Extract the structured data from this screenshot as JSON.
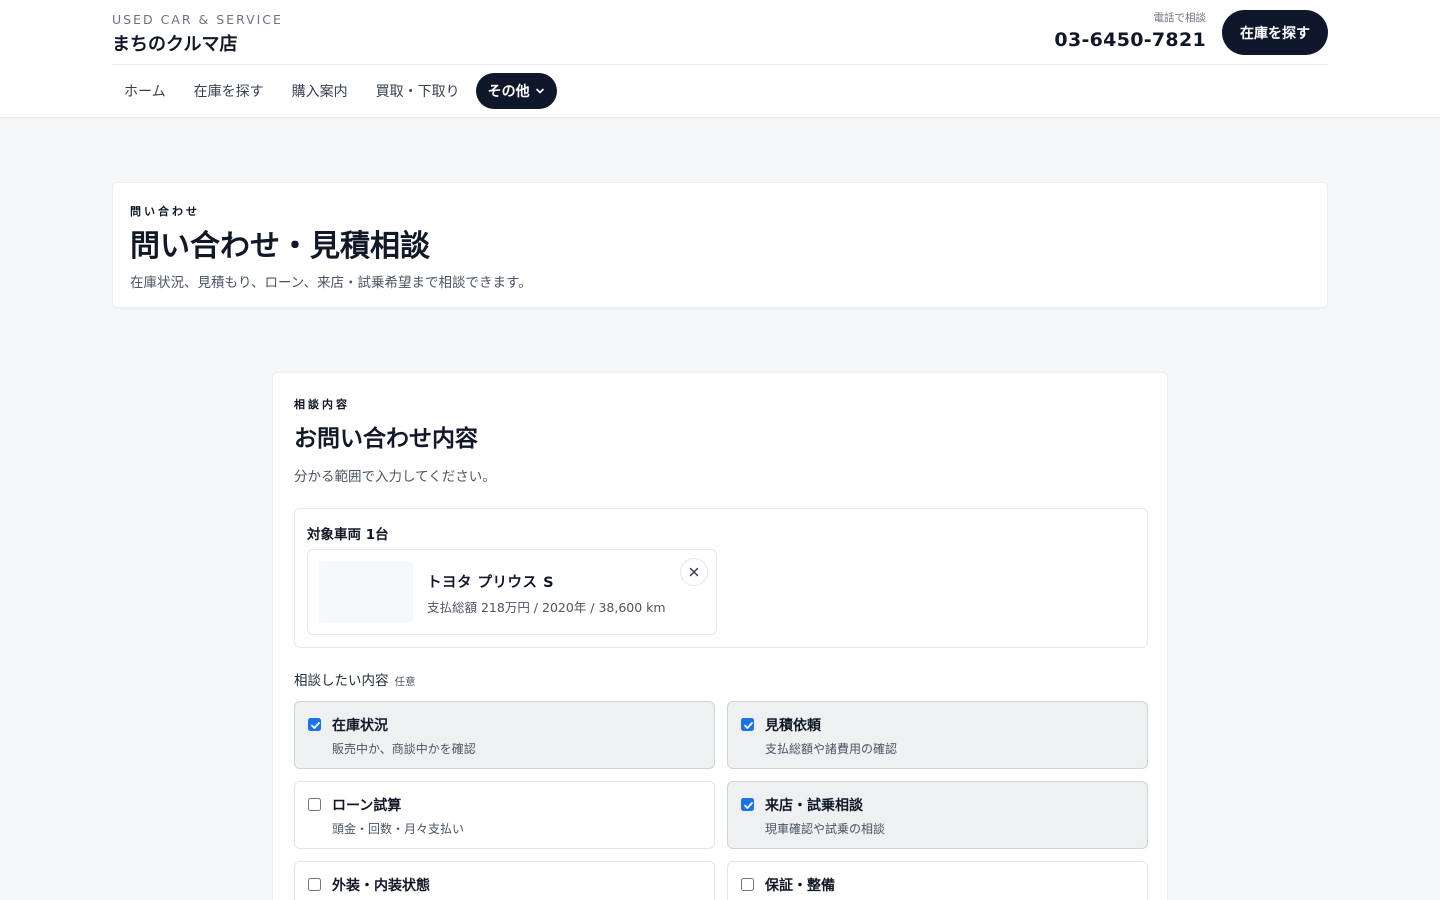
{
  "header": {
    "brand_sub": "USED CAR & SERVICE",
    "brand_name": "まちのクルマ店",
    "phone_label": "電話で相談",
    "phone_number": "03-6450-7821",
    "cta_label": "在庫を探す"
  },
  "nav": {
    "items": [
      {
        "label": "ホーム"
      },
      {
        "label": "在庫を探す"
      },
      {
        "label": "購入案内"
      },
      {
        "label": "買取・下取り"
      },
      {
        "label": "その他",
        "active": true
      }
    ]
  },
  "intro": {
    "eyebrow": "問い合わせ",
    "title": "問い合わせ・見積相談",
    "description": "在庫状況、見積もり、ローン、来店・試乗希望まで相談できます。"
  },
  "form": {
    "eyebrow": "相談内容",
    "title": "お問い合わせ内容",
    "description": "分かる範囲で入力してください。",
    "vehicle": {
      "heading": "対象車両 1台",
      "name": "トヨタ プリウス S",
      "meta": "支払総額 218万円 / 2020年 / 38,600 km"
    },
    "topics": {
      "label": "相談したい内容",
      "optional": "任意",
      "options": [
        {
          "title": "在庫状況",
          "desc": "販売中か、商談中かを確認",
          "checked": true
        },
        {
          "title": "見積依頼",
          "desc": "支払総額や諸費用の確認",
          "checked": true
        },
        {
          "title": "ローン試算",
          "desc": "頭金・回数・月々支払い",
          "checked": false
        },
        {
          "title": "来店・試乗相談",
          "desc": "現車確認や試乗の相談",
          "checked": true
        },
        {
          "title": "外装・内装状態",
          "desc": "",
          "checked": false
        },
        {
          "title": "保証・整備",
          "desc": "",
          "checked": false
        }
      ]
    }
  }
}
